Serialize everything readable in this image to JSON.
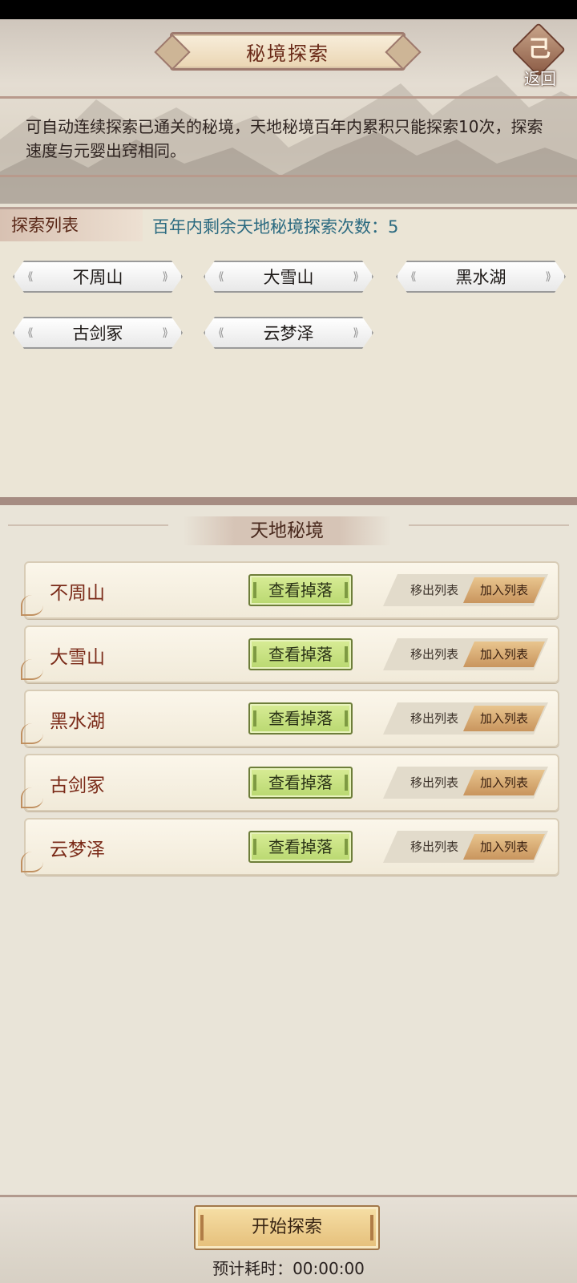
{
  "header": {
    "title": "秘境探索",
    "back_label": "返回",
    "back_glyph": "己",
    "description": "可自动连续探索已通关的秘境，天地秘境百年内累积只能探索10次，探索速度与元婴出窍相同。"
  },
  "explore_list": {
    "tab_label": "探索列表",
    "remaining_text": "百年内剩余天地秘境探索次数：5",
    "chips": [
      "不周山",
      "大雪山",
      "黑水湖",
      "古剑冢",
      "云梦泽"
    ]
  },
  "realm": {
    "heading": "天地秘境",
    "rows": [
      {
        "name": "不周山",
        "drop_label": "查看掉落",
        "remove_label": "移出列表",
        "add_label": "加入列表"
      },
      {
        "name": "大雪山",
        "drop_label": "查看掉落",
        "remove_label": "移出列表",
        "add_label": "加入列表"
      },
      {
        "name": "黑水湖",
        "drop_label": "查看掉落",
        "remove_label": "移出列表",
        "add_label": "加入列表"
      },
      {
        "name": "古剑冢",
        "drop_label": "查看掉落",
        "remove_label": "移出列表",
        "add_label": "加入列表"
      },
      {
        "name": "云梦泽",
        "drop_label": "查看掉落",
        "remove_label": "移出列表",
        "add_label": "加入列表"
      }
    ]
  },
  "footer": {
    "start_label": "开始探索",
    "eta_text": "预计耗时：00:00:00"
  }
}
